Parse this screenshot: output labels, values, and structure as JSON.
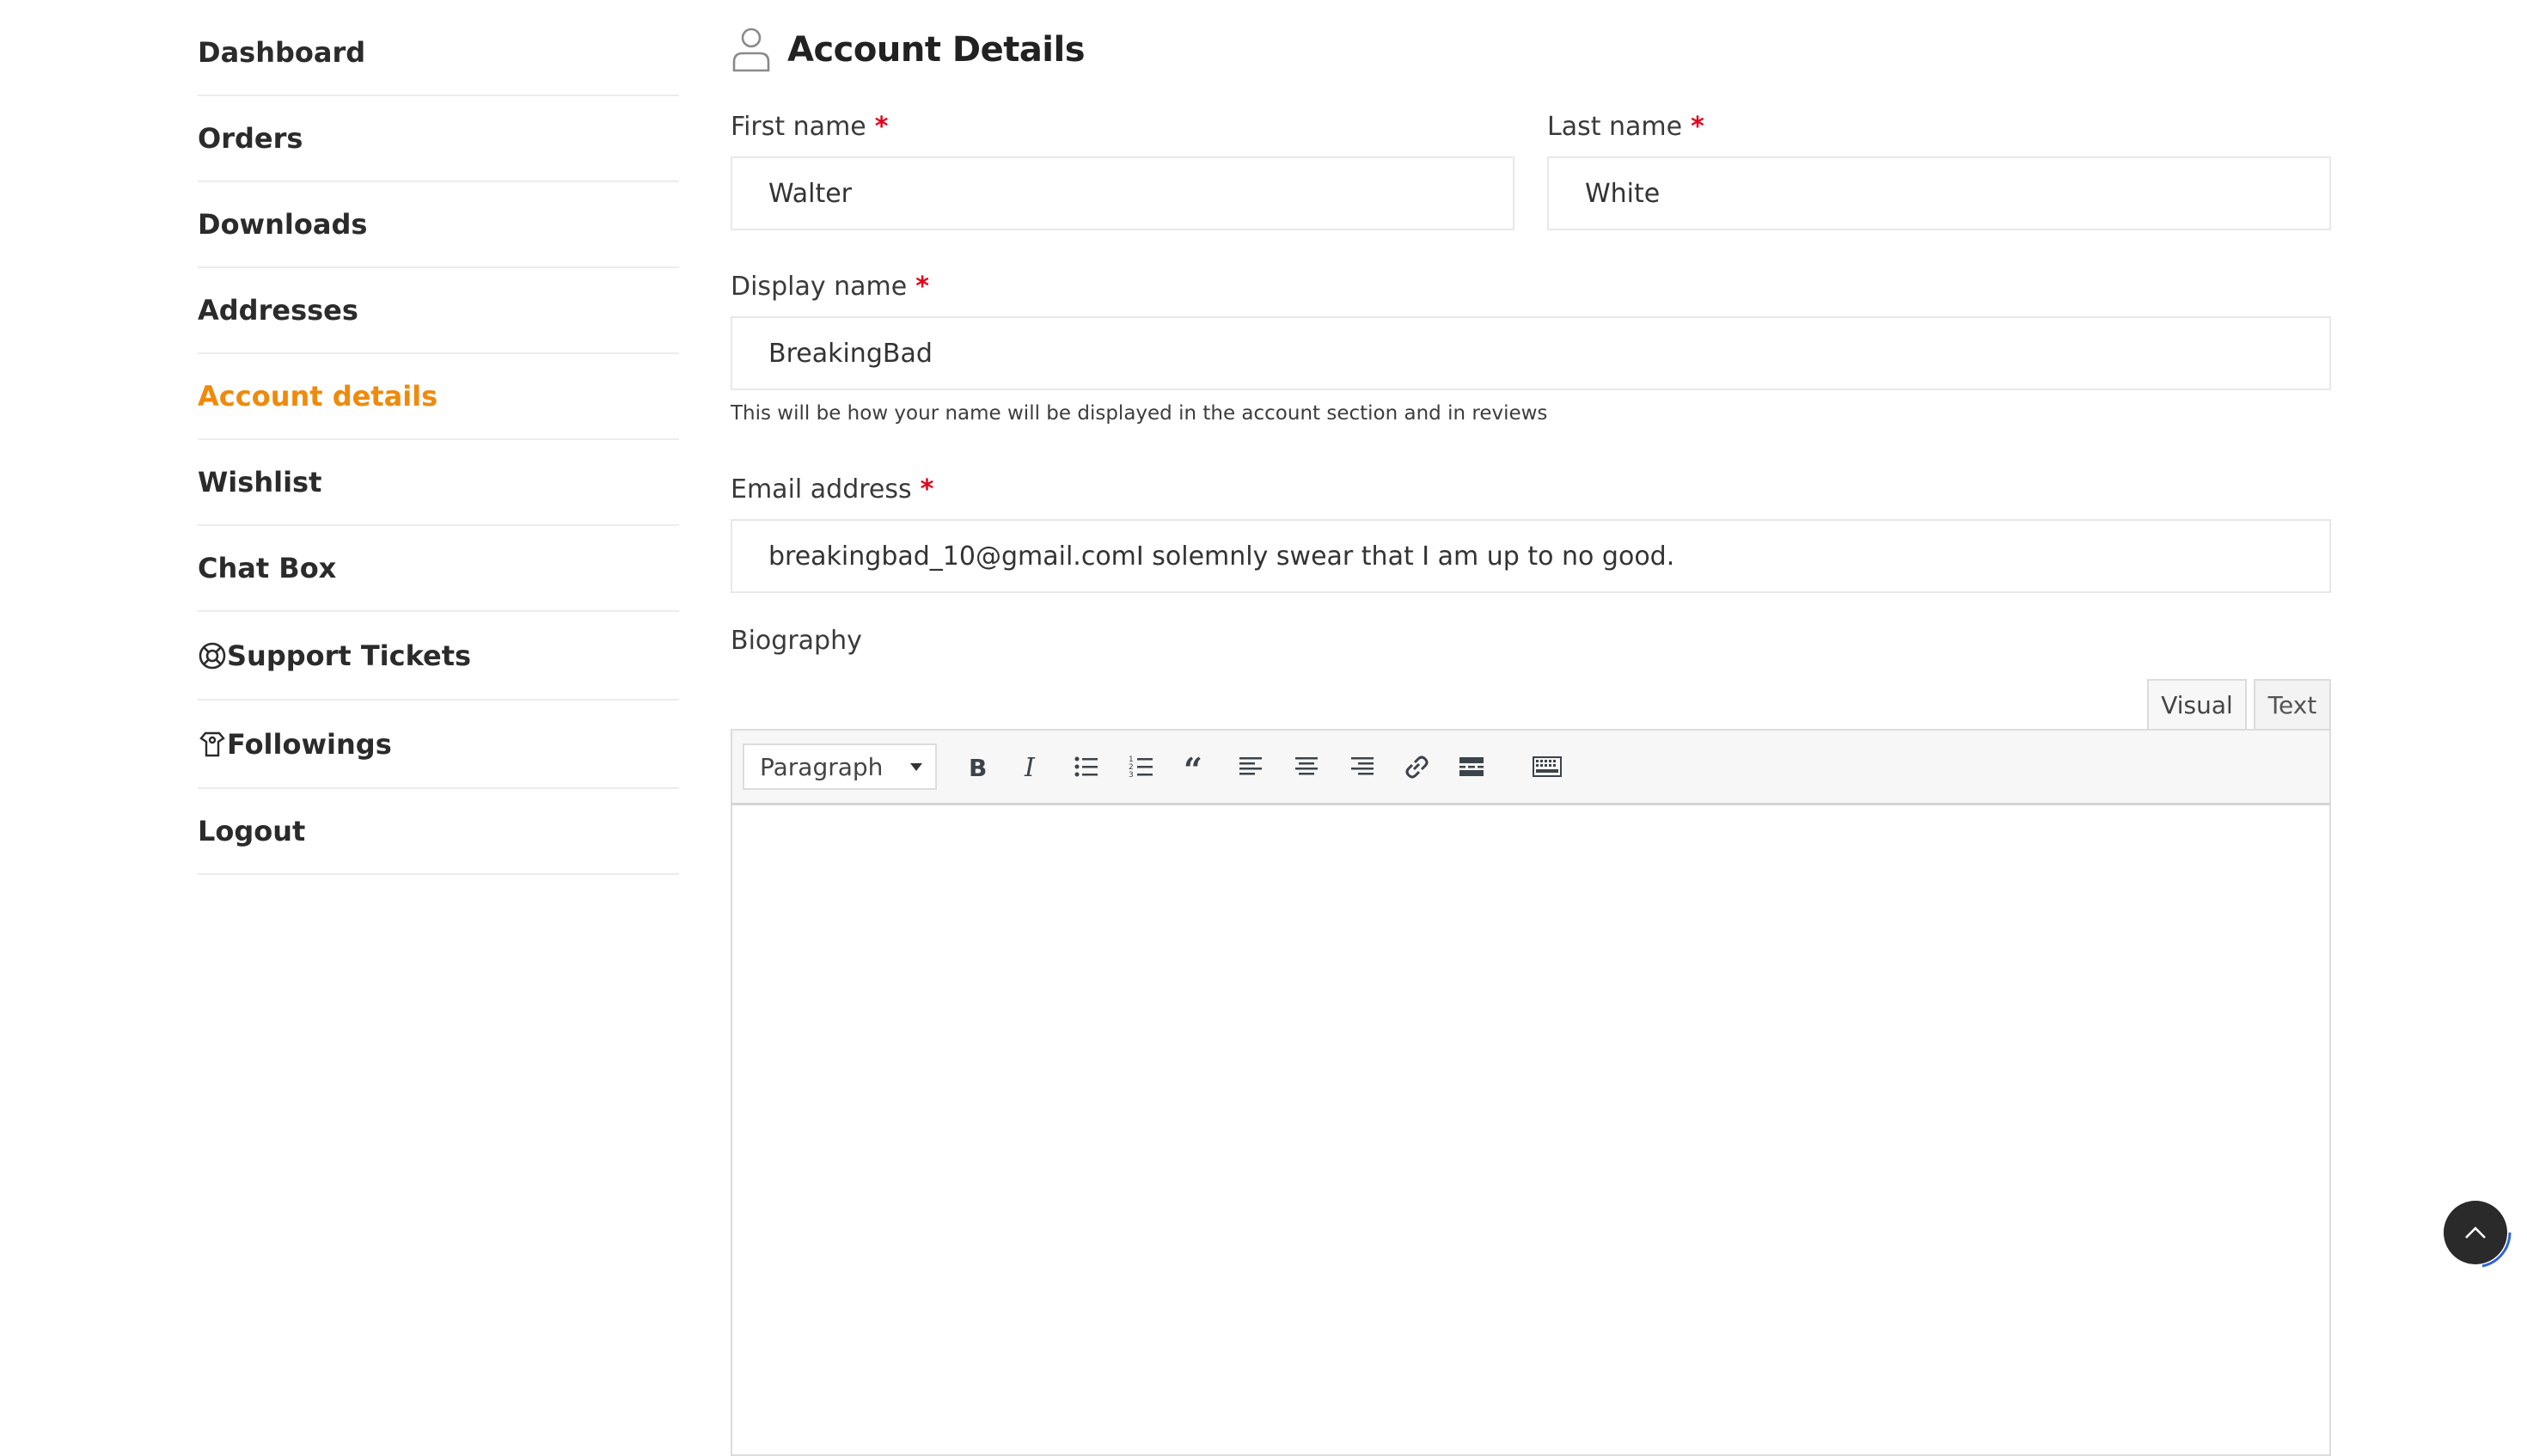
{
  "sidebar": {
    "items": [
      {
        "label": "Dashboard",
        "active": false,
        "icon": ""
      },
      {
        "label": "Orders",
        "active": false,
        "icon": ""
      },
      {
        "label": "Downloads",
        "active": false,
        "icon": ""
      },
      {
        "label": "Addresses",
        "active": false,
        "icon": ""
      },
      {
        "label": "Account details",
        "active": true,
        "icon": ""
      },
      {
        "label": "Wishlist",
        "active": false,
        "icon": ""
      },
      {
        "label": "Chat Box",
        "active": false,
        "icon": ""
      },
      {
        "label": "Support Tickets",
        "active": false,
        "icon": "lifebuoy-icon"
      },
      {
        "label": "Followings",
        "active": false,
        "icon": "followings-icon"
      },
      {
        "label": "Logout",
        "active": false,
        "icon": ""
      }
    ],
    "active_color": "#ef8a0c"
  },
  "main": {
    "title": "Account Details",
    "title_icon": "user-icon",
    "first_name": {
      "label": "First name",
      "required": "*",
      "value": "Walter"
    },
    "last_name": {
      "label": "Last name",
      "required": "*",
      "value": "White"
    },
    "display_name": {
      "label": "Display name",
      "required": "*",
      "value": "BreakingBad",
      "hint": "This will be how your name will be displayed in the account section and in reviews"
    },
    "email": {
      "label": "Email address",
      "required": "*",
      "value": "breakingbad_10@gmail.comI solemnly swear that I am up to no good."
    },
    "biography": {
      "label": "Biography",
      "tabs": {
        "visual": "Visual",
        "text": "Text"
      },
      "format_select": "Paragraph",
      "toolbar_icons": [
        "bold-icon",
        "italic-icon",
        "bulleted-list-icon",
        "numbered-list-icon",
        "blockquote-icon",
        "align-left-icon",
        "align-center-icon",
        "align-right-icon",
        "link-icon",
        "read-more-icon",
        "toolbar-toggle-icon"
      ]
    }
  },
  "scroll_top": {
    "icon": "chevron-up-icon"
  }
}
